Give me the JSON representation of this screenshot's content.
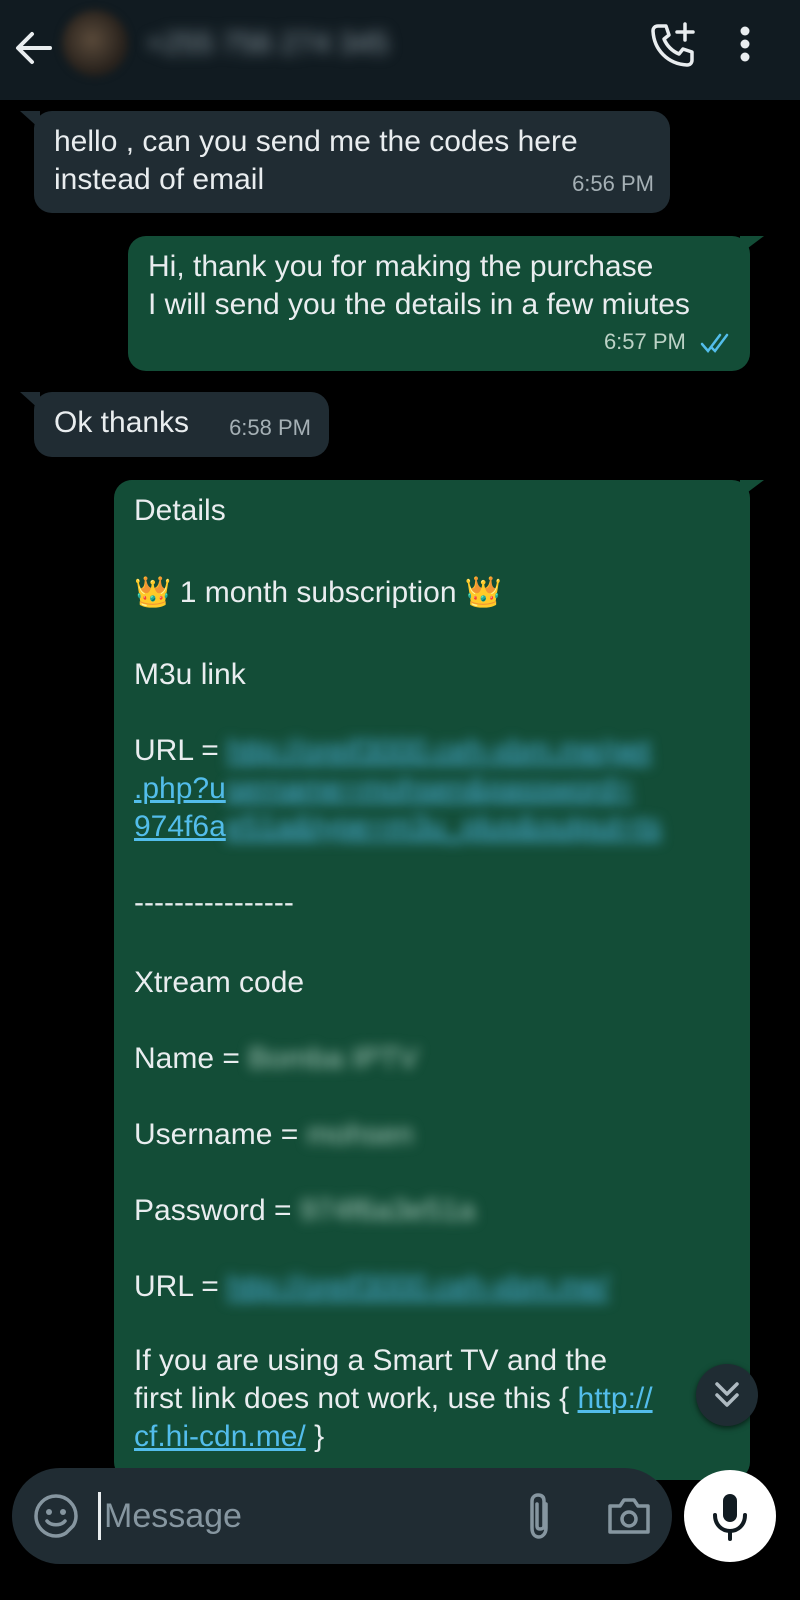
{
  "header": {
    "contact_name": "+255 756 274 345",
    "back_icon": "arrow-left-icon",
    "call_icon": "add-call-icon",
    "menu_icon": "more-vertical-icon"
  },
  "messages": [
    {
      "direction": "incoming",
      "lines": [
        "hello , can you send me the codes here",
        "instead of email"
      ],
      "time": "6:56 PM"
    },
    {
      "direction": "outgoing",
      "lines": [
        "Hi, thank you for making the purchase",
        "I will send you the details in a few miutes"
      ],
      "time": "6:57 PM",
      "status": "read"
    },
    {
      "direction": "incoming",
      "lines": [
        "Ok thanks"
      ],
      "time": "6:58 PM"
    }
  ],
  "details": {
    "title": "Details",
    "crown": "👑",
    "subscription": "1 month subscription",
    "m3u_heading": "M3u link",
    "url_label": "URL = ",
    "m3u_url_line1": "http://oreif3000.ceh-xbm.me/get",
    "m3u_url_line2_visible": ".php?u",
    "m3u_url_line2_blur": "sername=mohsen&password=",
    "m3u_url_line3_visible": "974f6a",
    "m3u_url_line3_blur": "e51a&type=m3u_plus&output=ts",
    "divider": "----------------",
    "xtream_heading": "Xtream code",
    "name_label": "Name = ",
    "name_value": "Bomba IPTV",
    "username_label": "Username = ",
    "username_value": "mohsen",
    "password_label": "Password = ",
    "password_value": "974f6a3e51a",
    "url2_label": "URL = ",
    "url2_value": "http://oreif3000.ceh-xbm.me/",
    "note_line1": "If you are using a Smart TV and the",
    "note_line2_prefix": "first link does not work, use this { ",
    "note_link_part1": "http://",
    "note_link_part2": "cf.hi-cdn.me/",
    "note_line3_suffix": " }"
  },
  "composer": {
    "placeholder": "Message",
    "emoji_icon": "sticker-icon",
    "attach_icon": "paperclip-icon",
    "camera_icon": "camera-icon",
    "mic_icon": "microphone-icon"
  },
  "scroll_button_icon": "double-chevron-down-icon",
  "colors": {
    "header_bg": "#111b21",
    "incoming_bubble": "#202c33",
    "outgoing_bubble": "#134d37",
    "link": "#53bdeb",
    "read_ticks": "#53bdeb"
  }
}
